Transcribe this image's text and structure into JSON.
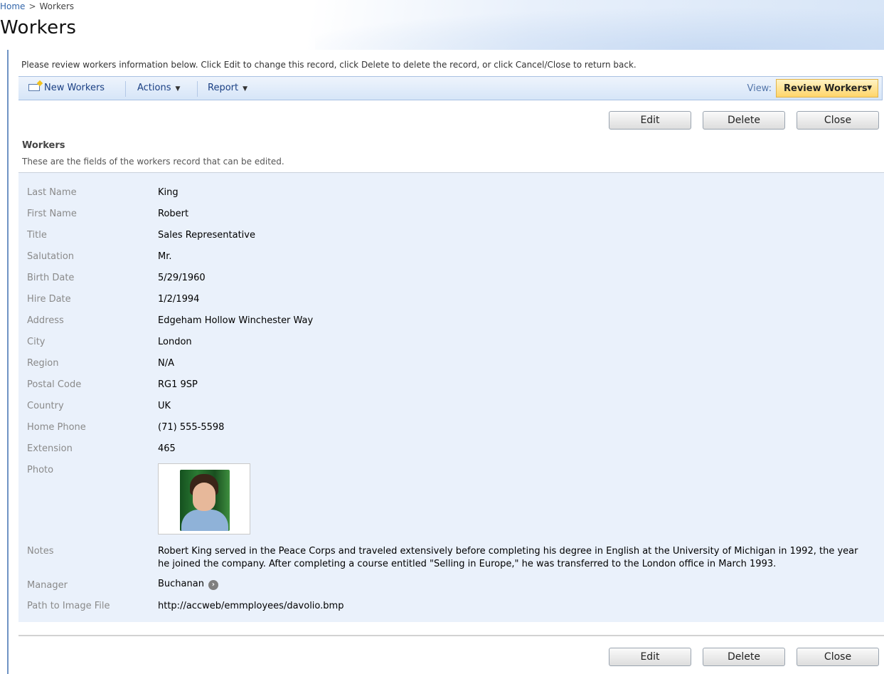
{
  "breadcrumb": {
    "home": "Home",
    "separator": ">",
    "current": "Workers"
  },
  "page": {
    "title": "Workers",
    "intro": "Please review workers information below. Click Edit to change this record, click Delete to delete the record, or click Cancel/Close to return back."
  },
  "toolbar": {
    "new_label": "New Workers",
    "actions_label": "Actions",
    "report_label": "Report",
    "view_label": "View:",
    "view_value": "Review Workers",
    "dropdown_glyph": "▼"
  },
  "buttons": {
    "edit": "Edit",
    "delete": "Delete",
    "close": "Close"
  },
  "section": {
    "title": "Workers",
    "description": "These are the fields of the workers record that can be edited."
  },
  "fields": {
    "last_name": {
      "label": "Last Name",
      "value": "King"
    },
    "first_name": {
      "label": "First Name",
      "value": "Robert"
    },
    "title": {
      "label": "Title",
      "value": "Sales Representative"
    },
    "salutation": {
      "label": "Salutation",
      "value": "Mr."
    },
    "birth_date": {
      "label": "Birth Date",
      "value": "5/29/1960"
    },
    "hire_date": {
      "label": "Hire Date",
      "value": "1/2/1994"
    },
    "address": {
      "label": "Address",
      "value": "Edgeham Hollow Winchester Way"
    },
    "city": {
      "label": "City",
      "value": "London"
    },
    "region": {
      "label": "Region",
      "value": "N/A"
    },
    "postal_code": {
      "label": "Postal Code",
      "value": "RG1 9SP"
    },
    "country": {
      "label": "Country",
      "value": "UK"
    },
    "home_phone": {
      "label": "Home Phone",
      "value": "(71) 555-5598"
    },
    "extension": {
      "label": "Extension",
      "value": "465"
    },
    "photo": {
      "label": "Photo"
    },
    "notes": {
      "label": "Notes",
      "value": "Robert King served in the Peace Corps and traveled extensively before completing his degree in English at the University of Michigan in 1992, the year he joined the company. After completing a course entitled \"Selling in Europe,\" he was transferred to the London office in March 1993."
    },
    "manager": {
      "label": "Manager",
      "value": "Buchanan"
    },
    "image_path": {
      "label": "Path to Image File",
      "value": "http://accweb/emmployees/davolio.bmp"
    }
  },
  "icons": {
    "new": "new-item-icon",
    "manager_link": "arrow-right-circle-icon"
  },
  "colors": {
    "toolbar_link": "#1a3f83",
    "view_highlight": "#ffd56a",
    "panel_bg": "#eaf1fb",
    "label": "#8a8a8a"
  }
}
